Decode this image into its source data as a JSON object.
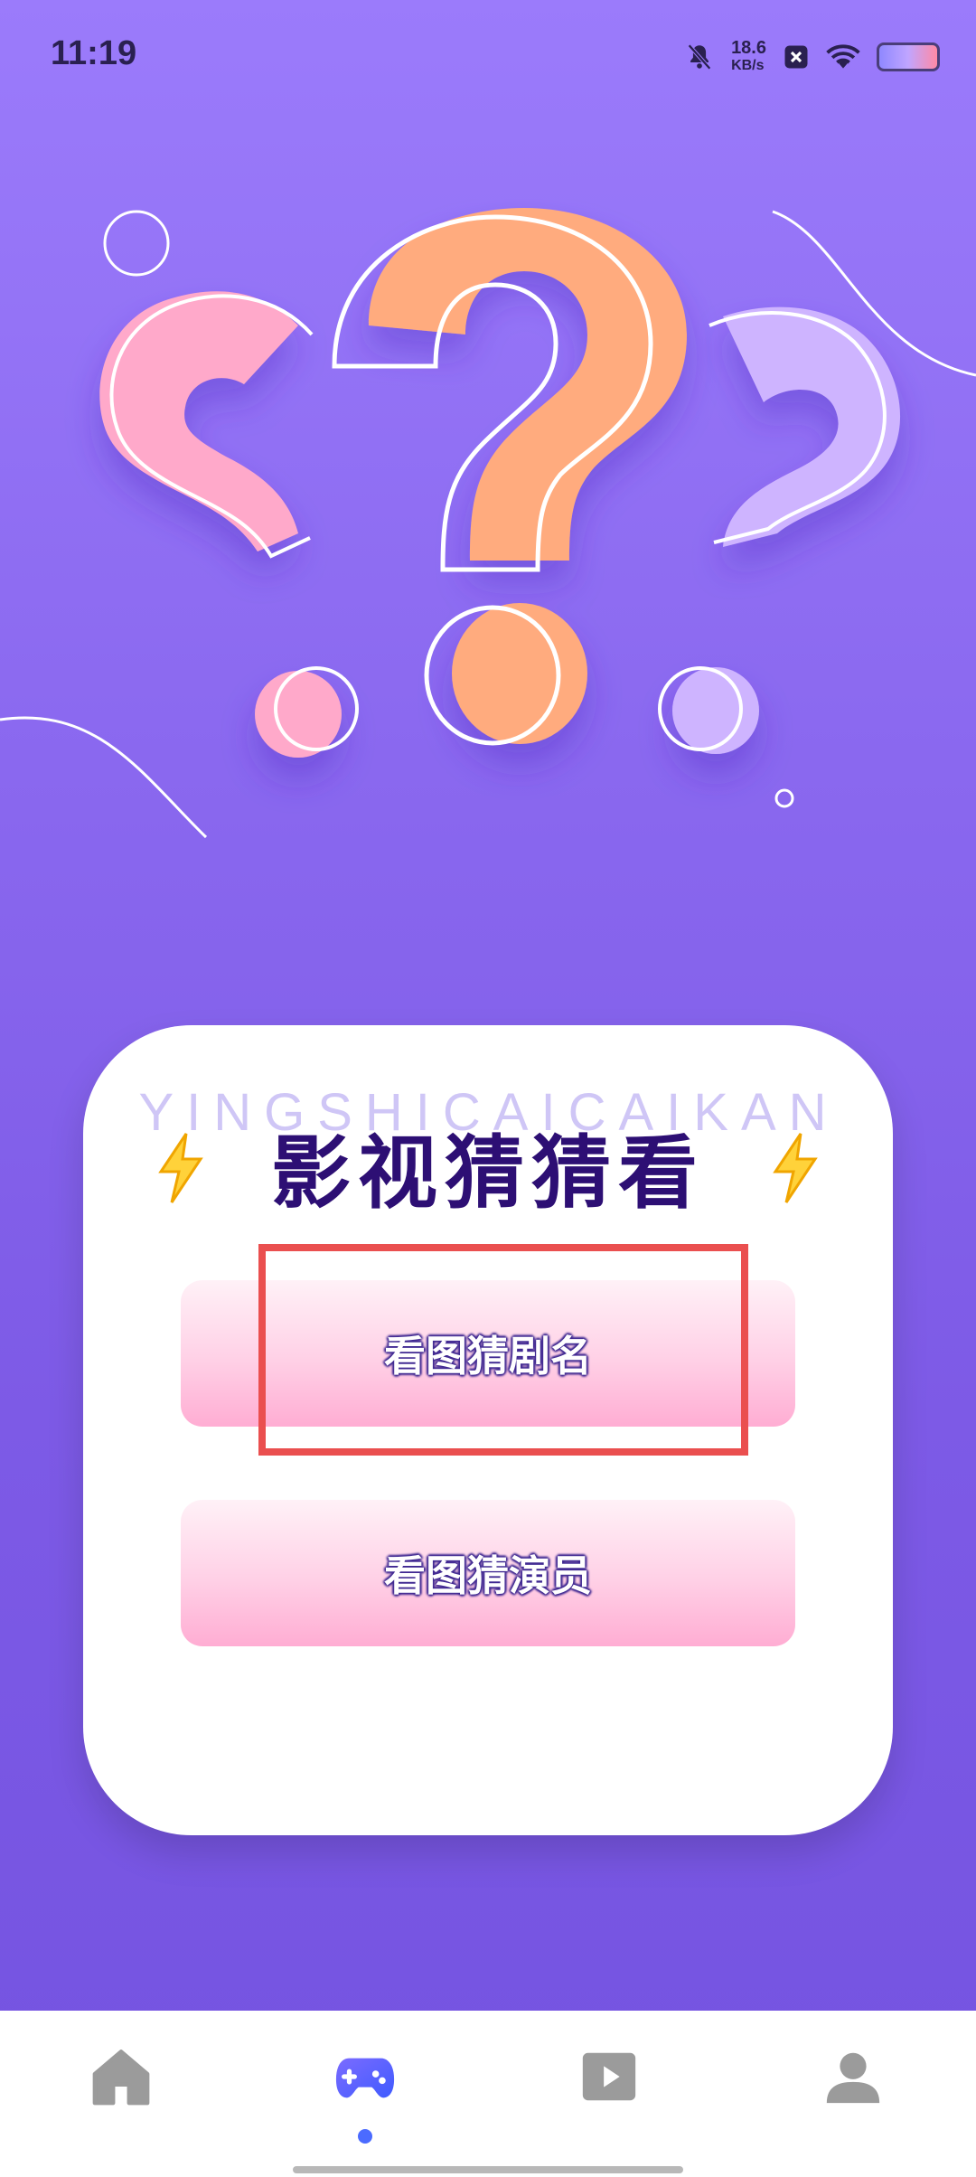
{
  "status_bar": {
    "time": "11:19",
    "net_speed_value": "18.6",
    "net_speed_unit": "KB/s"
  },
  "card": {
    "title": "影视猜猜看",
    "title_bg": "YINGSHICAICAIKAN",
    "buttons": [
      {
        "label": "看图猜剧名"
      },
      {
        "label": "看图猜演员"
      }
    ]
  },
  "bottom_nav": {
    "items": [
      {
        "icon": "home-icon",
        "active": false
      },
      {
        "icon": "game-controller-icon",
        "active": true
      },
      {
        "icon": "video-play-icon",
        "active": false
      },
      {
        "icon": "profile-icon",
        "active": false
      }
    ],
    "active_color": "#4b6bff"
  },
  "colors": {
    "highlight": "#ea4f4f",
    "title": "#2d0f74"
  }
}
